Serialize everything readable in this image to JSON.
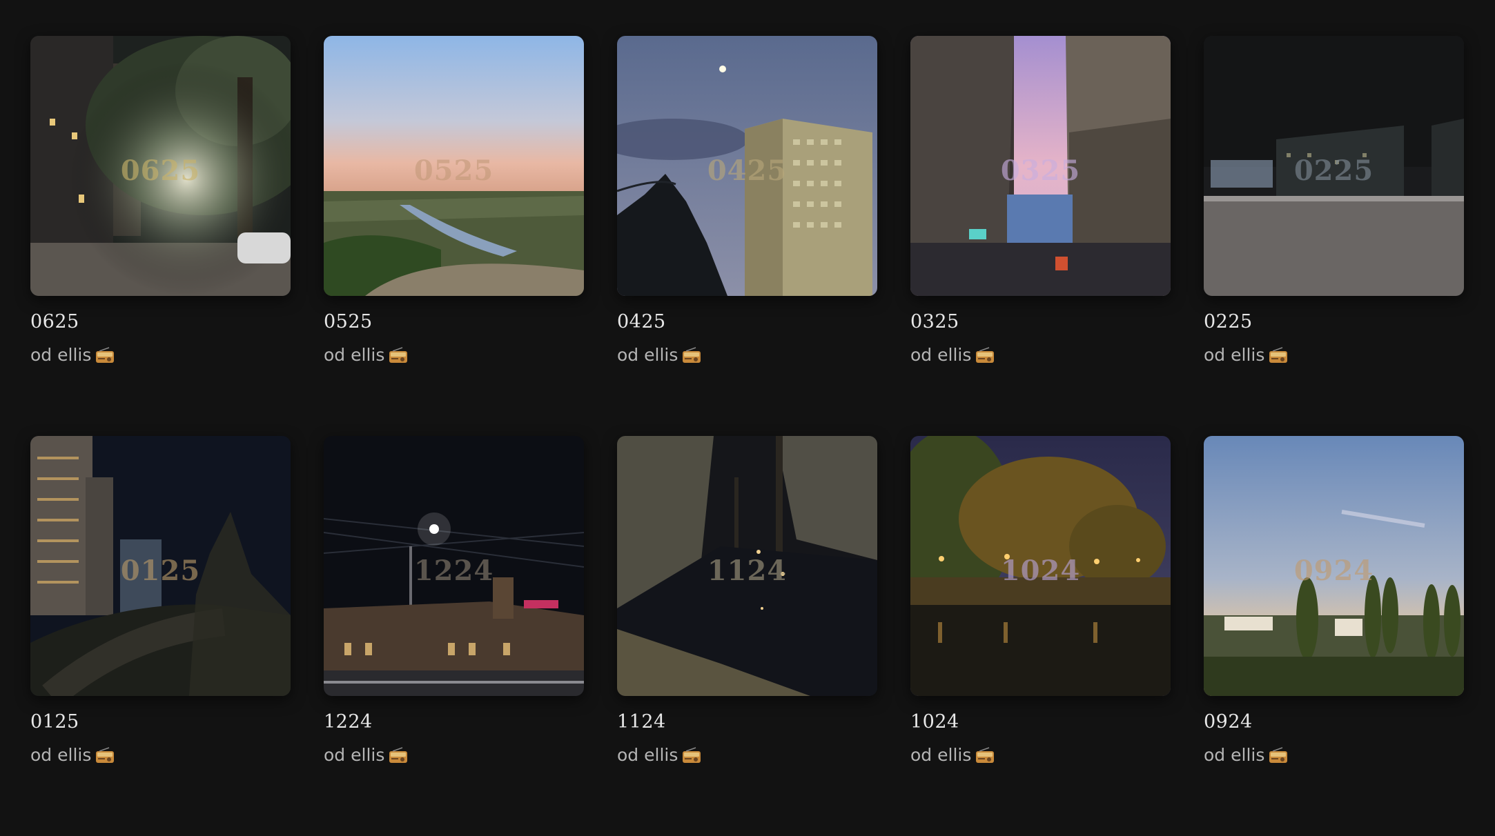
{
  "items": [
    {
      "title": "0625",
      "watermark": "0625",
      "author": "od ellis",
      "author_icon": "radio-icon",
      "scene": "night-street-tree",
      "watermark_color": "#c9b36a"
    },
    {
      "title": "0525",
      "watermark": "0525",
      "author": "od ellis",
      "author_icon": "radio-icon",
      "scene": "river-valley-dusk",
      "watermark_color": "#c49a7a"
    },
    {
      "title": "0425",
      "watermark": "0425",
      "author": "od ellis",
      "author_icon": "radio-icon",
      "scene": "tower-block-moon",
      "watermark_color": "#b8a77a"
    },
    {
      "title": "0325",
      "watermark": "0325",
      "author": "od ellis",
      "author_icon": "radio-icon",
      "scene": "street-pink-sky",
      "watermark_color": "#c8aee0"
    },
    {
      "title": "0225",
      "watermark": "0225",
      "author": "od ellis",
      "author_icon": "radio-icon",
      "scene": "night-rooftop",
      "watermark_color": "#7f8a95"
    },
    {
      "title": "0125",
      "watermark": "0125",
      "author": "od ellis",
      "author_icon": "radio-icon",
      "scene": "night-canal-towers",
      "watermark_color": "#b99a6a"
    },
    {
      "title": "1224",
      "watermark": "1224",
      "author": "od ellis",
      "author_icon": "radio-icon",
      "scene": "night-station",
      "watermark_color": "#8a8070"
    },
    {
      "title": "1124",
      "watermark": "1124",
      "author": "od ellis",
      "author_icon": "radio-icon",
      "scene": "night-park-branches",
      "watermark_color": "#a39a80"
    },
    {
      "title": "1024",
      "watermark": "1024",
      "author": "od ellis",
      "author_icon": "radio-icon",
      "scene": "autumn-pond-lights",
      "watermark_color": "#b8a4d8"
    },
    {
      "title": "0924",
      "watermark": "0924",
      "author": "od ellis",
      "author_icon": "radio-icon",
      "scene": "sunset-poplars",
      "watermark_color": "#c09a6e"
    }
  ]
}
